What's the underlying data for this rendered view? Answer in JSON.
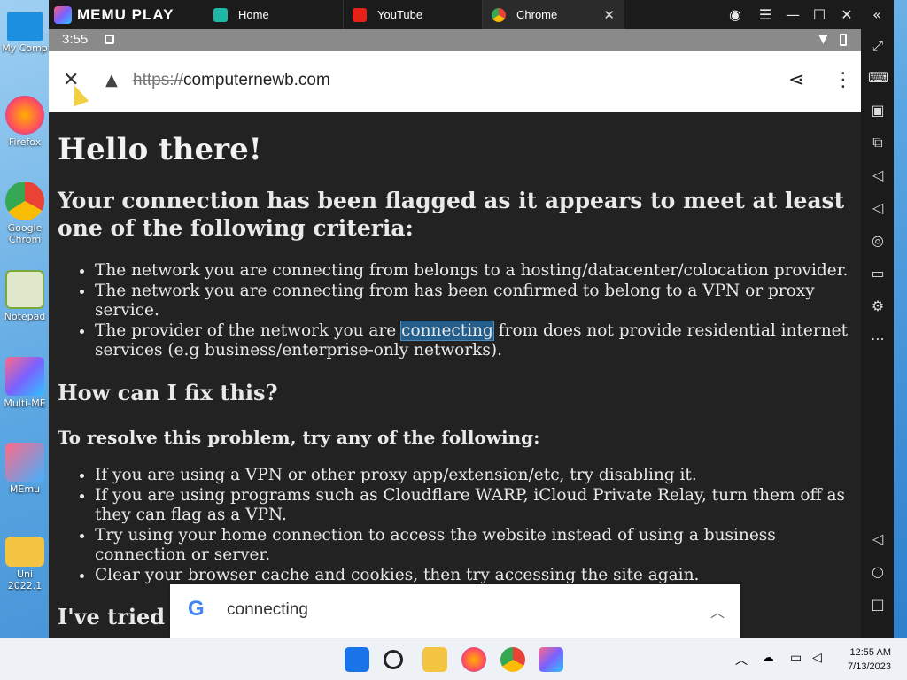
{
  "desktop": {
    "icons": [
      {
        "label": "My Comp"
      },
      {
        "label": "Firefox"
      },
      {
        "label": "Google Chrom"
      },
      {
        "label": "Notepad"
      },
      {
        "label": "Multi-ME"
      },
      {
        "label": "MEmu"
      },
      {
        "label": "Uni 2022.1"
      }
    ]
  },
  "emulator": {
    "brand": "MEMU PLAY",
    "tabs": [
      {
        "label": "Home"
      },
      {
        "label": "YouTube"
      },
      {
        "label": "Chrome"
      }
    ]
  },
  "status_bar": {
    "time": "3:55"
  },
  "browser": {
    "url_scheme": "https://",
    "url_host": "computernewb.com"
  },
  "page": {
    "h1": "Hello there!",
    "h2": "Your connection has been flagged as it appears to meet at least one of the following criteria:",
    "criteria": [
      "The network you are connecting from belongs to a hosting/datacenter/colocation provider.",
      "The network you are connecting from has been confirmed to belong to a VPN or proxy service."
    ],
    "criteria3_before": "The provider of the network you are ",
    "criteria3_match": "connecting",
    "criteria3_after": " from does not provide residential internet services (e.g business/enterprise-only networks).",
    "fix_heading": "How can I fix this?",
    "resolve_heading": "To resolve this problem, try any of the following:",
    "fixes": [
      "If you are using a VPN or other proxy app/extension/etc, try disabling it.",
      "If you are using programs such as Cloudflare WARP, iCloud Private Relay, turn them off as they can flag as a VPN.",
      "Try using your home connection to access the website instead of using a business connection or server.",
      "Clear your browser cache and cookies, then try accessing the site again."
    ],
    "tried_heading": "I've tried"
  },
  "find_bar": {
    "query": "connecting"
  },
  "taskbar": {
    "time": "12:55 AM",
    "date": "7/13/2023"
  },
  "colors": {
    "accent": "#255e8a",
    "page_bg": "#222222"
  }
}
